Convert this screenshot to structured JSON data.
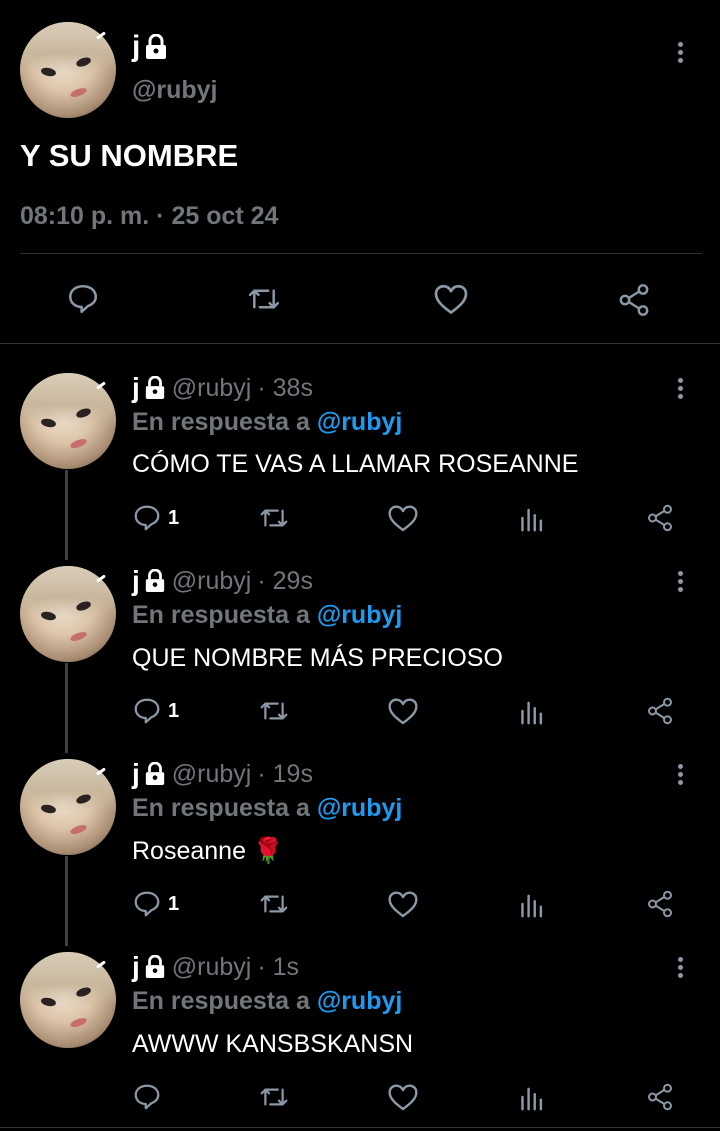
{
  "main_tweet": {
    "display_name": "j",
    "handle": "@rubyj",
    "text": "Y SU NOMBRE",
    "timestamp": "08:10 p. m. · 25 oct 24"
  },
  "replies": [
    {
      "display_name": "j",
      "handle": "@rubyj",
      "age": "· 38s",
      "replying_prefix": "En respuesta a",
      "replying_to": "@rubyj",
      "text": "CÓMO TE VAS A LLAMAR ROSEANNE",
      "reply_count": "1"
    },
    {
      "display_name": "j",
      "handle": "@rubyj",
      "age": "· 29s",
      "replying_prefix": "En respuesta a",
      "replying_to": "@rubyj",
      "text": "QUE NOMBRE MÁS PRECIOSO",
      "reply_count": "1"
    },
    {
      "display_name": "j",
      "handle": "@rubyj",
      "age": "· 19s",
      "replying_prefix": "En respuesta a",
      "replying_to": "@rubyj",
      "text": "Roseanne 🌹",
      "reply_count": "1"
    },
    {
      "display_name": "j",
      "handle": "@rubyj",
      "age": "· 1s",
      "replying_prefix": "En respuesta a",
      "replying_to": "@rubyj",
      "text": "AWWW KANSBSKANSN",
      "reply_count": ""
    }
  ],
  "icons": [
    "lock-icon",
    "more-icon",
    "reply-icon",
    "retweet-icon",
    "like-icon",
    "share-icon",
    "views-icon"
  ],
  "colors": {
    "background": "#000000",
    "muted": "#71767b",
    "link": "#1d9bf0",
    "text": "#ffffff"
  }
}
